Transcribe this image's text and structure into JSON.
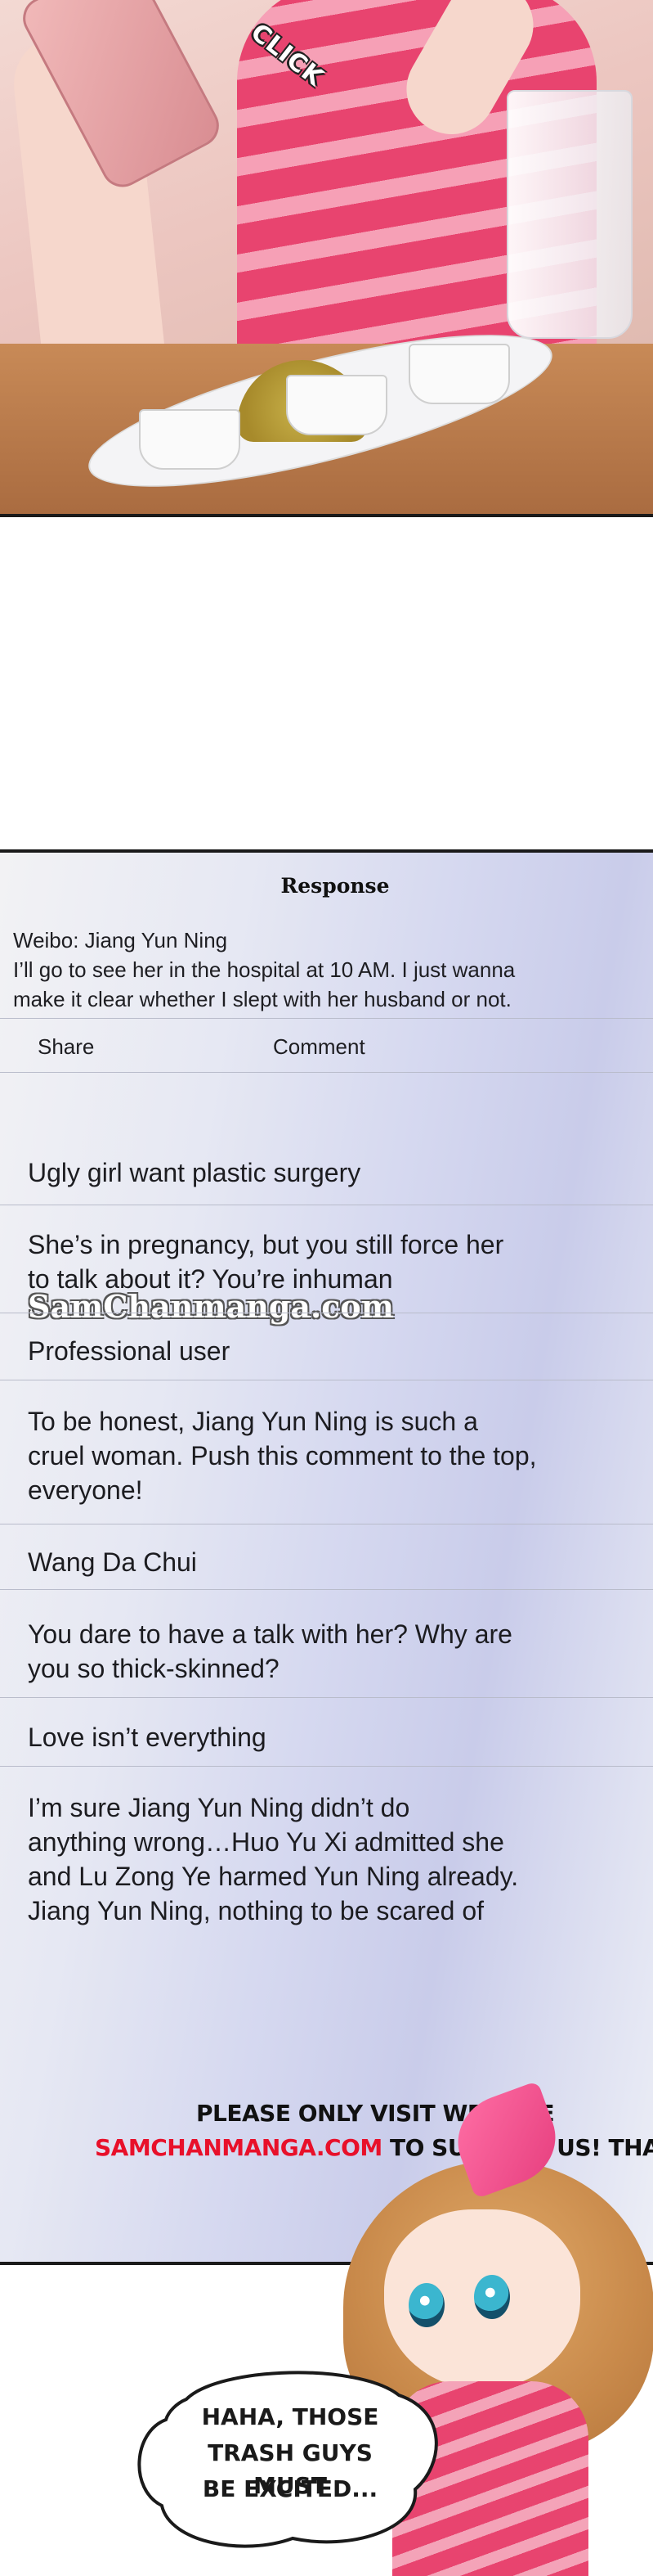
{
  "top_panel": {
    "sound_effect": "CLICK"
  },
  "screen": {
    "header": {
      "title": "Response"
    },
    "post": {
      "author_line": "Weibo: Jiang Yun Ning",
      "text_line_1": "I’ll go to see her in the hospital at 10 AM. I just wanna",
      "text_line_2": "make it clear whether I slept with her husband or not."
    },
    "actions": {
      "share": "Share",
      "comment": "Comment"
    },
    "comments": [
      {
        "line1": "Ugly girl want plastic surgery",
        "line2": "",
        "line3": ""
      },
      {
        "line1": "She’s in pregnancy, but you still force her",
        "line2": " to talk about it? You’re inhuman",
        "line3": ""
      },
      {
        "line1": "Professional user",
        "line2": "",
        "line3": ""
      },
      {
        "line1": "To be honest, Jiang Yun Ning is such a",
        "line2": "cruel woman. Push this comment to the top,",
        "line3": "everyone!"
      },
      {
        "line1": "Wang Da Chui",
        "line2": "",
        "line3": ""
      },
      {
        "line1": "You dare to have a talk with her? Why are",
        "line2": "you so thick-skinned?",
        "line3": ""
      },
      {
        "line1": "Love isn’t everything",
        "line2": "",
        "line3": ""
      },
      {
        "line1": "I’m sure Jiang Yun Ning didn’t do",
        "line2": "anything wrong…Huo Yu Xi admitted she",
        "line3": "and Lu Zong Ye harmed Yun Ning already."
      },
      {
        "line1": "Jiang Yun Ning, nothing to be scared of",
        "line2": "",
        "line3": ""
      }
    ],
    "watermark": "SamChanmanga.com"
  },
  "translator_note": {
    "line1": "PLEASE ONLY VISIT WEBSITE",
    "site": "SAMCHANMANGA.COM",
    "line2_rest": " TO SUPPORT US! THANK YOU",
    "site_color": "#e8102a",
    "text_color": "#111111"
  },
  "speech_bubble": {
    "line1": "HAHA, THOSE",
    "line2": "TRASH GUYS MUST",
    "line3": "BE EXCITED..."
  }
}
